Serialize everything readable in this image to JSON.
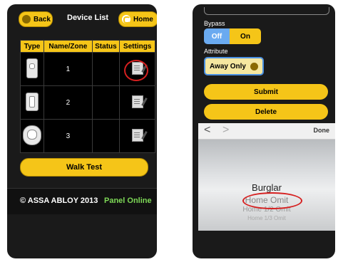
{
  "left_screen": {
    "header": {
      "back_label": "Back",
      "title": "Device List",
      "home_label": "Home"
    },
    "table": {
      "columns": [
        "Type",
        "Name/Zone",
        "Status",
        "Settings"
      ],
      "rows": [
        {
          "zone": "1",
          "type_icon": "door-sensor-icon",
          "status": ""
        },
        {
          "zone": "2",
          "type_icon": "window-sensor-icon",
          "status": ""
        },
        {
          "zone": "3",
          "type_icon": "motion-sensor-icon",
          "status": ""
        }
      ]
    },
    "walk_test_label": "Walk Test",
    "footer": {
      "copyright": "© ASSA ABLOY 2013",
      "status": "Panel Online"
    }
  },
  "right_screen": {
    "bypass": {
      "label": "Bypass",
      "off_label": "Off",
      "on_label": "On"
    },
    "attribute": {
      "label": "Attribute",
      "value": "Away Only"
    },
    "submit_label": "Submit",
    "delete_label": "Delete",
    "picker": {
      "prev": "<",
      "next": ">",
      "done_label": "Done",
      "options": [
        "Burglar",
        "Home Omit",
        "Home 1/2 Omit",
        "Home 1/3 Omit"
      ]
    }
  },
  "colors": {
    "accent_yellow": "#f5c518",
    "background": "#1a1a1a",
    "toggle_blue": "#6aaaf0",
    "online_green": "#7ed957",
    "highlight_red": "#d62020"
  }
}
